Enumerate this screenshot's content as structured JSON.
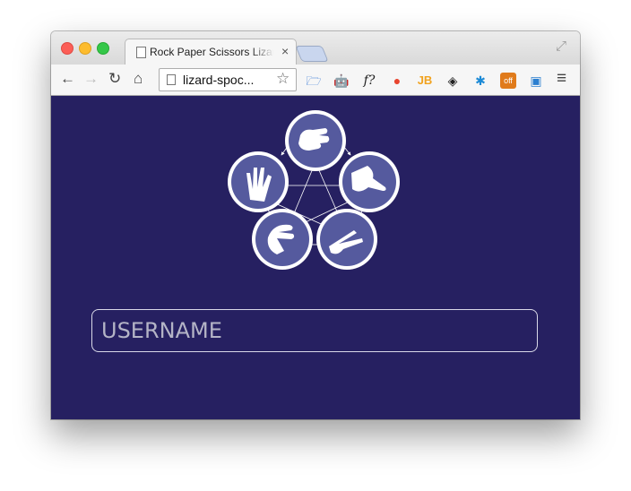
{
  "browser": {
    "tab_title": "Rock Paper Scissors Lizard",
    "tab_close": "×",
    "url": "lizard-spoc...",
    "nav": {
      "back": "←",
      "forward": "→",
      "reload": "↻",
      "home": "⌂"
    },
    "star": "☆",
    "fullscreen": "⤢",
    "menu": "≡",
    "extensions": [
      {
        "name": "folder-extension",
        "glyph": "🗁",
        "color": "#3a7bd5"
      },
      {
        "name": "robot-extension",
        "glyph": "🤖",
        "color": "#2a6fa8"
      },
      {
        "name": "font-question-extension",
        "glyph": "f?",
        "color": "#222222"
      },
      {
        "name": "red-stop-extension",
        "glyph": "●",
        "color": "#e8452f"
      },
      {
        "name": "jb-extension",
        "glyph": "JB",
        "color": "#f1a21e"
      },
      {
        "name": "layers-extension",
        "glyph": "◈",
        "color": "#222222"
      },
      {
        "name": "bug-extension",
        "glyph": "✱",
        "color": "#1c8ad6"
      },
      {
        "name": "off-extension",
        "glyph": "off",
        "color": "#e07b1b"
      },
      {
        "name": "screenshot-extension",
        "glyph": "▣",
        "color": "#2b7fd0"
      }
    ]
  },
  "page": {
    "background": "#262061",
    "username_placeholder": "USERNAME",
    "logo_gestures": [
      "rock",
      "paper",
      "scissors",
      "lizard",
      "spock"
    ]
  }
}
